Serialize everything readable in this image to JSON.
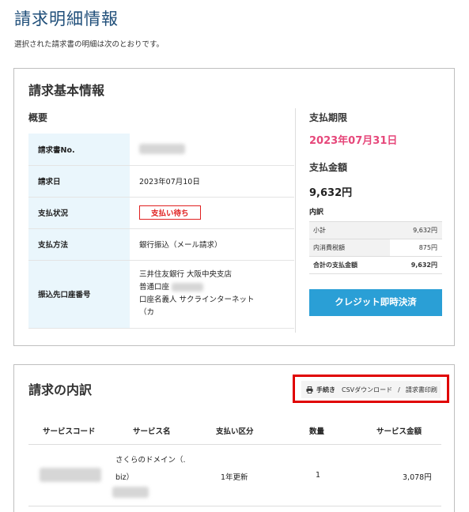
{
  "page": {
    "title": "請求明細情報",
    "description": "選択された請求書の明細は次のとおりです。"
  },
  "basic": {
    "title": "請求基本情報",
    "overview_heading": "概要",
    "rows": [
      {
        "label": "請求書No.",
        "value": ""
      },
      {
        "label": "請求日",
        "value": "2023年07月10日"
      },
      {
        "label": "支払状況",
        "value": "支払い待ち"
      },
      {
        "label": "支払方法",
        "value": "銀行振込（メール請求）"
      },
      {
        "label": "振込先口座番号",
        "value_lines": [
          "三井住友銀行 大阪中央支店",
          "普通口座",
          "口座名義人 サクラインターネット",
          "（カ"
        ]
      }
    ],
    "due_heading": "支払期限",
    "due_date": "2023年07月31日",
    "amount_heading": "支払金額",
    "amount": "9,632円",
    "breakdown_heading": "内訳",
    "breakdown": [
      {
        "label": "小計",
        "value": "9,632円"
      },
      {
        "label": "内消費税額",
        "value": "875円"
      },
      {
        "label": "合計の支払金額",
        "value": "9,632円"
      }
    ],
    "credit_button": "クレジット即時決済",
    "status_color": "#e02020",
    "due_color": "#e6477a",
    "button_color": "#2a9fd6"
  },
  "details": {
    "title": "請求の内訳",
    "procedure_label": "手続き",
    "csv_link": "CSVダウンロード",
    "separator": "/",
    "print_link": "請求書印刷",
    "headers": [
      "サービスコード",
      "サービス名",
      "支払い区分",
      "数量",
      "サービス金額"
    ],
    "rows": [
      {
        "code": "",
        "name_lines": [
          "さくらのドメイン（.",
          "biz）"
        ],
        "type": "1年更新",
        "qty": "1",
        "amount": "3,078円"
      }
    ]
  }
}
